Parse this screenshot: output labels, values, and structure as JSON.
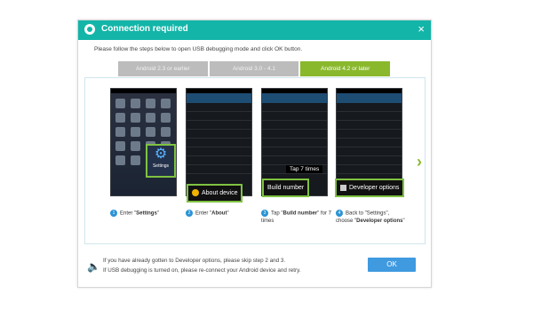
{
  "dialog": {
    "title": "Connection required",
    "close_glyph": "×",
    "instruction": "Please follow the steps below to open USB debugging mode and click OK button.",
    "tabs": [
      {
        "label": "Android 2.3 or earlier",
        "active": false
      },
      {
        "label": "Android 3.0 - 4.1",
        "active": false
      },
      {
        "label": "Android 4.2 or later",
        "active": true
      }
    ],
    "steps": [
      {
        "num": "1",
        "text_pre": "Enter \"",
        "text_bold": "Settings",
        "text_post": "\"",
        "callout": "Settings"
      },
      {
        "num": "2",
        "text_pre": "Enter \"",
        "text_bold": "About",
        "text_post": "\"",
        "callout": "About device"
      },
      {
        "num": "3",
        "text_pre": "Tap \"",
        "text_bold": "Build number",
        "text_post": "\" for 7 times",
        "callout": "Build number",
        "badge": "Tap 7 times"
      },
      {
        "num": "4",
        "text_pre": "Back to \"Settings\", choose \"",
        "text_bold": "Developer options",
        "text_post": "\"",
        "callout": "Developer options"
      }
    ],
    "notes": [
      "If you have already gotten to Developer options, please skip step 2 and 3.",
      "If USB debugging is turned on, please re-connect your Android device and retry."
    ],
    "ok_label": "OK"
  },
  "colors": {
    "titlebar": "#13b5a8",
    "tab_active": "#8ab82c",
    "tab_inactive": "#bcbcbc",
    "ok_button": "#3f9ae0",
    "highlight_border": "#7fc242"
  },
  "icons": [
    "app-logo-icon",
    "close-icon",
    "gear-icon",
    "bulb-icon",
    "next-arrow-icon",
    "speaker-icon"
  ]
}
